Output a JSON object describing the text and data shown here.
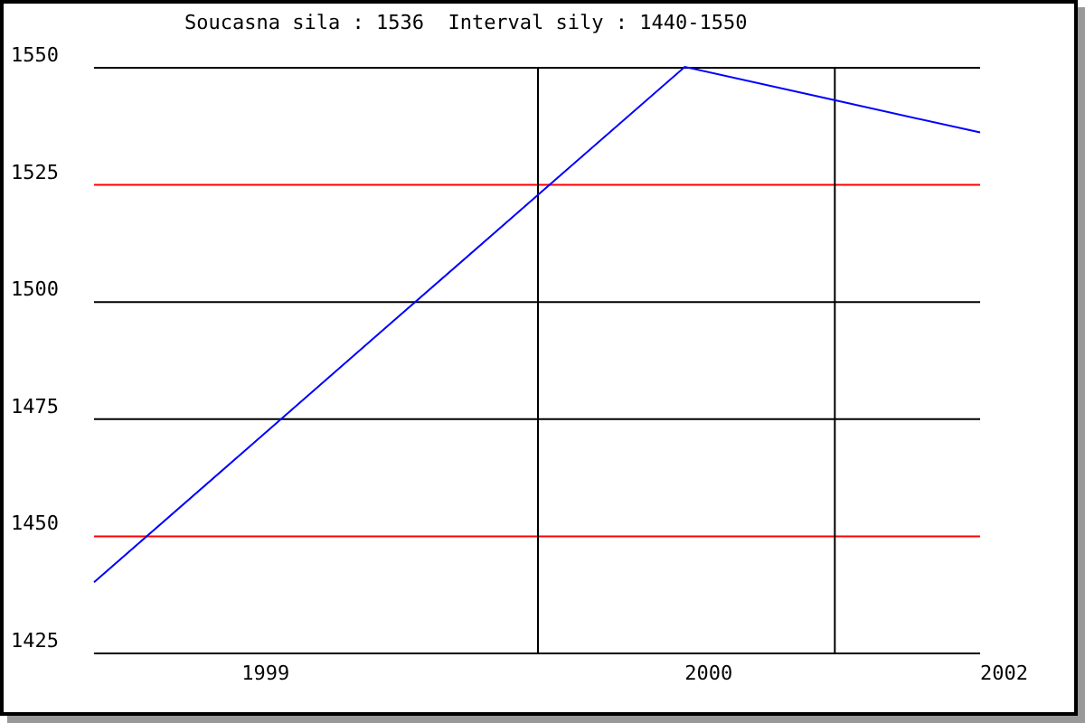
{
  "chart_data": {
    "type": "line",
    "title": "Soucasna sila : 1536  Interval sily : 1440-1550",
    "ylim": [
      1425,
      1550
    ],
    "grid": true,
    "categories": [
      null,
      "1999",
      null,
      null,
      "2000",
      null,
      "2002"
    ],
    "yticks": [
      1425,
      1450,
      1475,
      1500,
      1525,
      1550
    ],
    "series": [
      {
        "color": "#0000ff",
        "values": [
          1440,
          1467.5,
          1495,
          1522.5,
          1550,
          1543,
          1536
        ]
      }
    ]
  }
}
